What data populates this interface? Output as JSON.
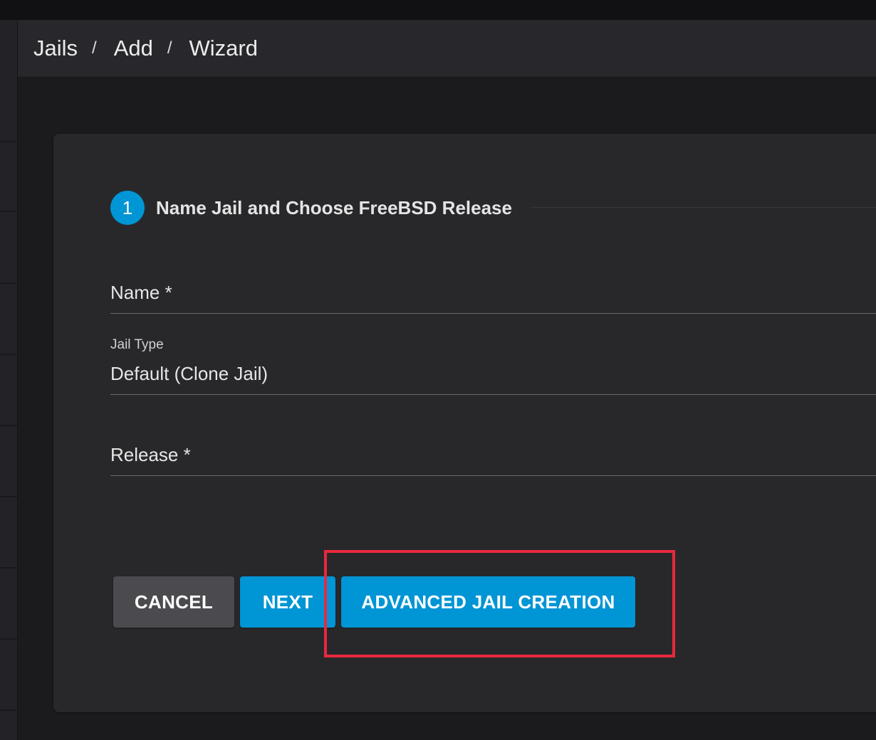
{
  "breadcrumb": {
    "items": [
      "Jails",
      "Add",
      "Wizard"
    ],
    "separator": "/"
  },
  "wizard": {
    "step_number": "1",
    "step_title": "Name Jail and Choose FreeBSD Release"
  },
  "form": {
    "name_label": "Name *",
    "jail_type_label": "Jail Type",
    "jail_type_value": "Default (Clone Jail)",
    "release_label": "Release *"
  },
  "actions": {
    "cancel_label": "CANCEL",
    "next_label": "NEXT",
    "advanced_label": "ADVANCED JAIL CREATION"
  },
  "colors": {
    "accent": "#0095d5",
    "cancel_button": "#4b4b4f",
    "highlight": "#e8283e",
    "card_background": "#28282b",
    "page_background": "#1b1b1e"
  }
}
